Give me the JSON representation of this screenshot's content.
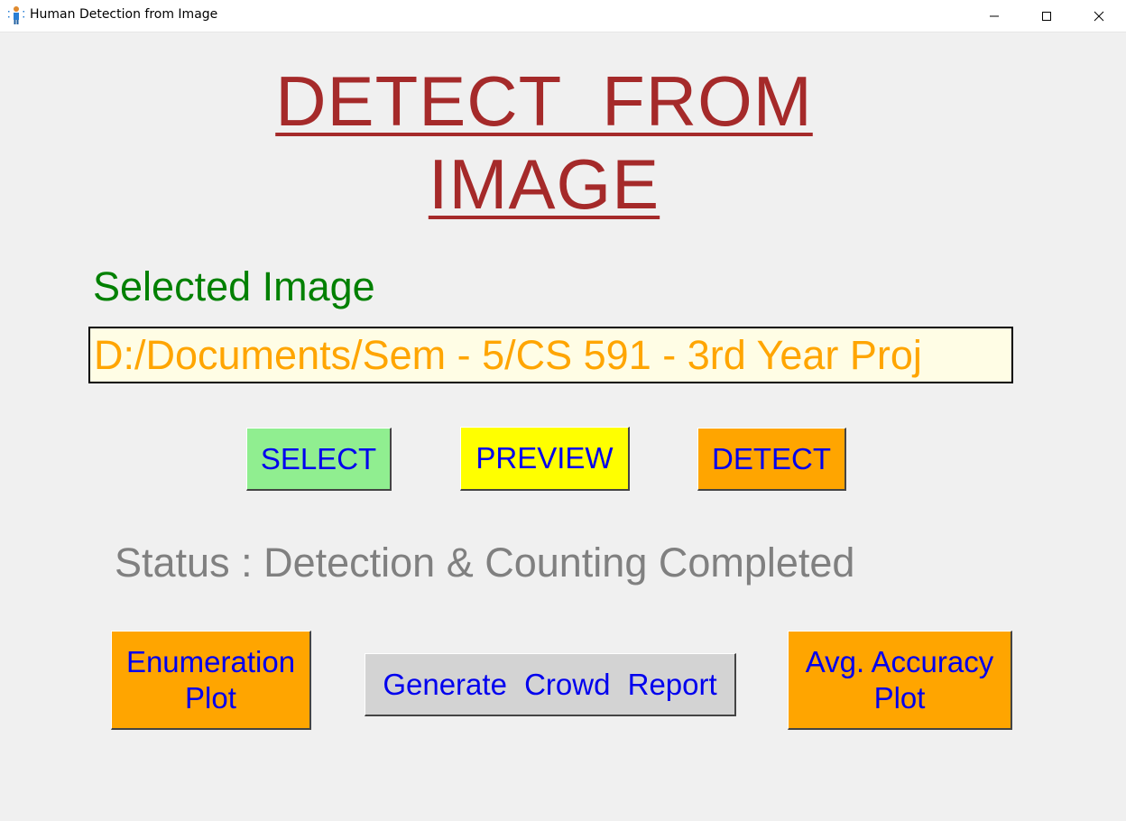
{
  "window": {
    "title": "Human Detection from Image",
    "controls": {
      "minimize_icon": "minimize-icon",
      "maximize_icon": "maximize-icon",
      "close_icon": "close-icon"
    },
    "app_icon": "person-icon"
  },
  "main": {
    "title_line1": "DETECT  FROM",
    "title_line2": "IMAGE",
    "selected_label": "Selected Image",
    "path_value": "D:/Documents/Sem - 5/CS 591 - 3rd Year Proj",
    "status": "Status : Detection & Counting Completed"
  },
  "buttons": {
    "select": "SELECT",
    "preview": "PREVIEW",
    "detect": "DETECT",
    "enumeration_line1": "Enumeration",
    "enumeration_line2": "Plot",
    "report": "Generate  Crowd  Report",
    "accuracy_line1": "Avg. Accuracy",
    "accuracy_line2": "Plot"
  },
  "colors": {
    "title": "#a52a2a",
    "selected_label": "#008000",
    "path_text": "#ffa500",
    "path_bg": "#fffde5",
    "status": "#808080",
    "button_text": "#0000ee",
    "select_bg": "#90ee90",
    "preview_bg": "#ffff00",
    "detect_bg": "#ffa500",
    "plot_bg": "#ffa500",
    "report_bg": "#d3d3d3",
    "window_bg": "#f0f0f0"
  }
}
